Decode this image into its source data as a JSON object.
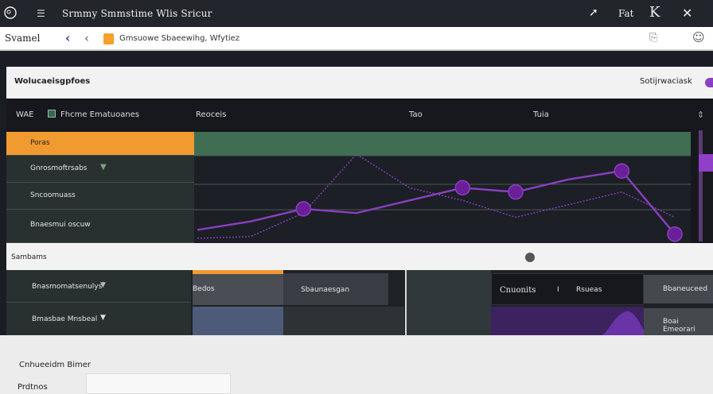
{
  "window": {
    "title": "Srmmy Smmstime Wlis Sricur",
    "right_label": "Fat"
  },
  "address_bar": {
    "site_label": "Svamel",
    "address": "Gmsuowe Sbaeewihg, Wfytiez"
  },
  "panel": {
    "title": "Wolucaeisgpfoes",
    "toggle_label": "Sotijrwaciask"
  },
  "columns": {
    "c1": "WAE",
    "c2": "Fhcme Ematuoanes",
    "c3": "Reoceis",
    "c4": "Tao",
    "c5": "Tuia"
  },
  "rows": [
    {
      "label": "Poras"
    },
    {
      "label": "Gnrosmoftrsabs"
    },
    {
      "label": "Sncoomuass"
    },
    {
      "label": "Bnaesmui oscuw"
    }
  ],
  "chart_data": {
    "type": "line",
    "series": [
      {
        "values": [
          0.0,
          0.02,
          0.3,
          1.0,
          0.6,
          0.45,
          0.25,
          0.4,
          0.55,
          0.25
        ]
      },
      {
        "values": [
          0.1,
          0.2,
          0.35,
          0.3,
          0.45,
          0.6,
          0.55,
          0.7,
          0.8,
          0.05
        ]
      }
    ],
    "markers": [
      {
        "series": 1,
        "index": 2
      },
      {
        "series": 1,
        "index": 5
      },
      {
        "series": 1,
        "index": 6
      },
      {
        "series": 1,
        "index": 8
      },
      {
        "series": 1,
        "index": 9
      }
    ],
    "colors": {
      "line": "#8a3fc0",
      "marker": "#6a1f98",
      "band": "#3f6e52"
    }
  },
  "section": {
    "title": "Sambams"
  },
  "lower": {
    "row1_label": "Bnasmomatsenulys",
    "row2_label": "Bmasbae Mnsbeal",
    "tab_label": "Bedos",
    "cell_label": "Sbaunaesgan",
    "contents_label": "Cnuonits",
    "contents_sep": "I",
    "contents_value": "Rsueas",
    "right1": "Bbaneuceed",
    "right2": "Boai Emeorari"
  },
  "footer": {
    "line1": "Cnhueeidm Bimer",
    "line2": "Prdtnos"
  }
}
